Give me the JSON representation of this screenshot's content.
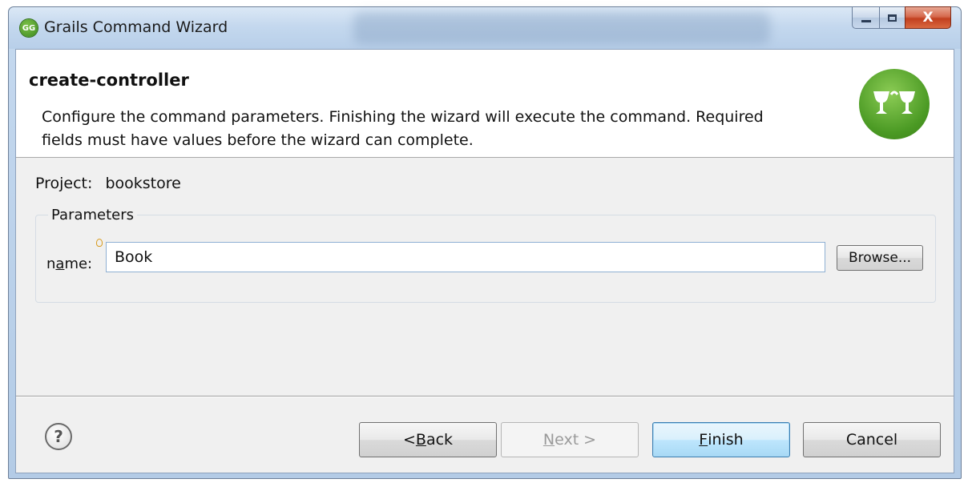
{
  "window": {
    "title": "Grails Command Wizard",
    "app_icon_text": "GG",
    "minimize_label": "",
    "maximize_label": "",
    "close_label": "X"
  },
  "header": {
    "title": "create-controller",
    "description_line1": "Configure the command parameters. Finishing the wizard will execute the command. Required",
    "description_line2": "fields must have values before the wizard can complete.",
    "logo_icon": "grails-goblet-icon"
  },
  "project": {
    "label": "Project:",
    "value": "bookstore"
  },
  "parameters": {
    "legend": "Parameters",
    "name_label_prefix": "n",
    "name_label_mnemonic": "a",
    "name_label_suffix": "me:",
    "name_value": "Book",
    "required_marker_icon": "lightbulb-icon",
    "browse_label": "Browse..."
  },
  "footer": {
    "help_label": "?",
    "back_prefix": "< ",
    "back_mnemonic": "B",
    "back_suffix": "ack",
    "next_mnemonic": "N",
    "next_suffix": "ext >",
    "finish_mnemonic": "F",
    "finish_suffix": "inish",
    "cancel_label": "Cancel"
  },
  "colors": {
    "grails_green": "#4b9a24",
    "default_button_border": "#3c7fb1",
    "close_red": "#c2401f"
  }
}
